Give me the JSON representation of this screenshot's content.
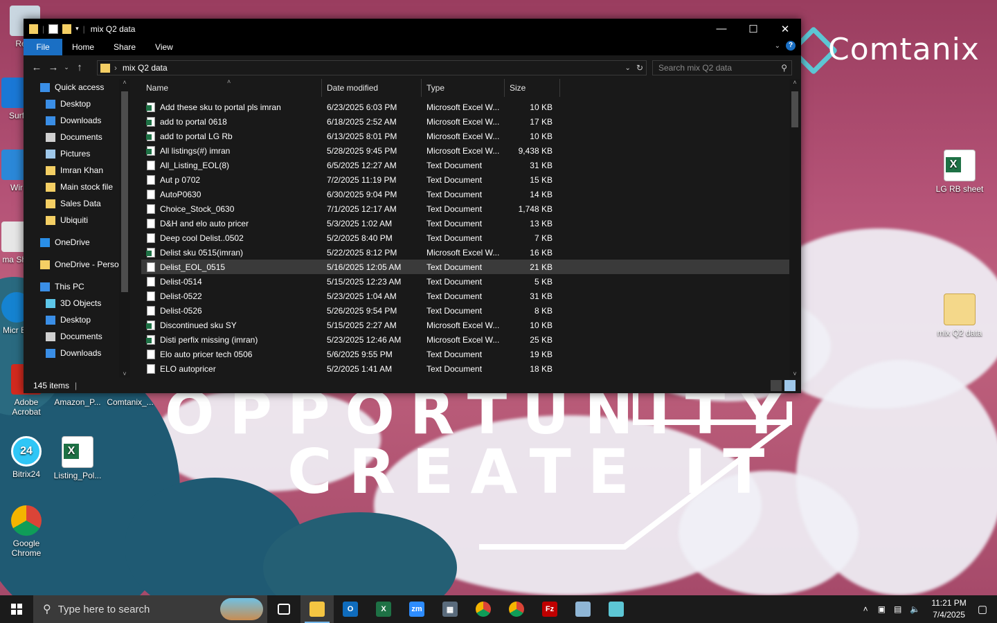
{
  "desktop": {
    "brand": "Comtanix",
    "slogan_line1": "OPPORTUNITY",
    "slogan_line2": "CREATE IT",
    "icons_left": [
      {
        "label": "Recy"
      },
      {
        "label": "Surf"
      },
      {
        "label": "Wir"
      },
      {
        "label": "ma Sho"
      },
      {
        "label": "Micr Ec"
      },
      {
        "label": "Adobe Acrobat"
      },
      {
        "label": "Amazon_P..."
      },
      {
        "label": "Comtanix_..."
      },
      {
        "label": "Bitrix24"
      },
      {
        "label": "Listing_Pol..."
      },
      {
        "label": "Google Chrome"
      }
    ],
    "icons_right": [
      {
        "label": "LG RB sheet"
      },
      {
        "label": "mix Q2 data"
      }
    ]
  },
  "window": {
    "title": "mix Q2 data",
    "ribbon_tabs": [
      "File",
      "Home",
      "Share",
      "View"
    ],
    "address": {
      "crumb": "mix Q2 data"
    },
    "search_placeholder": "Search mix Q2 data",
    "nav": [
      {
        "label": "Quick access",
        "icon": "star-icon",
        "indent": 1,
        "pinned": false
      },
      {
        "label": "Desktop",
        "icon": "desktop-icon",
        "indent": 2,
        "pinned": true
      },
      {
        "label": "Downloads",
        "icon": "download-icon",
        "indent": 2,
        "pinned": true
      },
      {
        "label": "Documents",
        "icon": "document-icon",
        "indent": 2,
        "pinned": true
      },
      {
        "label": "Pictures",
        "icon": "pictures-icon",
        "indent": 2,
        "pinned": true
      },
      {
        "label": "Imran Khan",
        "icon": "folder-icon",
        "indent": 2,
        "pinned": false
      },
      {
        "label": "Main stock file",
        "icon": "folder-icon",
        "indent": 2,
        "pinned": false
      },
      {
        "label": "Sales Data",
        "icon": "folder-icon",
        "indent": 2,
        "pinned": false
      },
      {
        "label": "Ubiquiti",
        "icon": "folder-icon",
        "indent": 2,
        "pinned": false
      },
      {
        "label": "",
        "icon": "",
        "indent": 0,
        "pinned": false
      },
      {
        "label": "OneDrive",
        "icon": "cloud-icon",
        "indent": 1,
        "pinned": false
      },
      {
        "label": "",
        "icon": "",
        "indent": 0,
        "pinned": false
      },
      {
        "label": "OneDrive - Persor",
        "icon": "folder-icon",
        "indent": 1,
        "pinned": false
      },
      {
        "label": "",
        "icon": "",
        "indent": 0,
        "pinned": false
      },
      {
        "label": "This PC",
        "icon": "pc-icon",
        "indent": 1,
        "pinned": false
      },
      {
        "label": "3D Objects",
        "icon": "cube-icon",
        "indent": 2,
        "pinned": false
      },
      {
        "label": "Desktop",
        "icon": "desktop-icon",
        "indent": 2,
        "pinned": false
      },
      {
        "label": "Documents",
        "icon": "document-icon",
        "indent": 2,
        "pinned": false
      },
      {
        "label": "Downloads",
        "icon": "download-icon",
        "indent": 2,
        "pinned": false
      }
    ],
    "columns": [
      "Name",
      "Date modified",
      "Type",
      "Size"
    ],
    "files": [
      {
        "name": "Add these sku to portal pls imran",
        "date": "6/23/2025 6:03 PM",
        "type": "Microsoft Excel W...",
        "size": "10 KB",
        "kind": "xl"
      },
      {
        "name": "add to portal 0618",
        "date": "6/18/2025 2:52 AM",
        "type": "Microsoft Excel W...",
        "size": "17 KB",
        "kind": "xl"
      },
      {
        "name": "add to portal LG Rb",
        "date": "6/13/2025 8:01 PM",
        "type": "Microsoft Excel W...",
        "size": "10 KB",
        "kind": "xl"
      },
      {
        "name": "All listings(#) imran",
        "date": "5/28/2025 9:45 PM",
        "type": "Microsoft Excel W...",
        "size": "9,438 KB",
        "kind": "xl"
      },
      {
        "name": "All_Listing_EOL(8)",
        "date": "6/5/2025 12:27 AM",
        "type": "Text Document",
        "size": "31 KB",
        "kind": "txt"
      },
      {
        "name": "Aut p 0702",
        "date": "7/2/2025 11:19 PM",
        "type": "Text Document",
        "size": "15 KB",
        "kind": "txt"
      },
      {
        "name": "AutoP0630",
        "date": "6/30/2025 9:04 PM",
        "type": "Text Document",
        "size": "14 KB",
        "kind": "txt"
      },
      {
        "name": "Choice_Stock_0630",
        "date": "7/1/2025 12:17 AM",
        "type": "Text Document",
        "size": "1,748 KB",
        "kind": "txt"
      },
      {
        "name": "D&H and elo auto pricer",
        "date": "5/3/2025 1:02 AM",
        "type": "Text Document",
        "size": "13 KB",
        "kind": "txt"
      },
      {
        "name": "Deep cool Delist..0502",
        "date": "5/2/2025 8:40 PM",
        "type": "Text Document",
        "size": "7 KB",
        "kind": "txt"
      },
      {
        "name": "Delist sku 0515(imran)",
        "date": "5/22/2025 8:12 PM",
        "type": "Microsoft Excel W...",
        "size": "16 KB",
        "kind": "xl"
      },
      {
        "name": "Delist_EOL_0515",
        "date": "5/16/2025 12:05 AM",
        "type": "Text Document",
        "size": "21 KB",
        "kind": "txt",
        "selected": true
      },
      {
        "name": "Delist-0514",
        "date": "5/15/2025 12:23 AM",
        "type": "Text Document",
        "size": "5 KB",
        "kind": "txt"
      },
      {
        "name": "Delist-0522",
        "date": "5/23/2025 1:04 AM",
        "type": "Text Document",
        "size": "31 KB",
        "kind": "txt"
      },
      {
        "name": "Delist-0526",
        "date": "5/26/2025 9:54 PM",
        "type": "Text Document",
        "size": "8 KB",
        "kind": "txt"
      },
      {
        "name": "Discontinued sku SY",
        "date": "5/15/2025 2:27 AM",
        "type": "Microsoft Excel W...",
        "size": "10 KB",
        "kind": "xl"
      },
      {
        "name": "Disti perfix missing (imran)",
        "date": "5/23/2025 12:46 AM",
        "type": "Microsoft Excel W...",
        "size": "25 KB",
        "kind": "xl"
      },
      {
        "name": "Elo auto pricer tech 0506",
        "date": "5/6/2025 9:55 PM",
        "type": "Text Document",
        "size": "19 KB",
        "kind": "txt"
      },
      {
        "name": "ELO autopricer",
        "date": "5/2/2025 1:41 AM",
        "type": "Text Document",
        "size": "18 KB",
        "kind": "txt"
      }
    ],
    "status": "145 items"
  },
  "taskbar": {
    "search_placeholder": "Type here to search",
    "apps": [
      {
        "name": "task-view-icon",
        "label": "",
        "color": "#1b1b1b"
      },
      {
        "name": "file-explorer-icon",
        "label": "",
        "color": "#f4c542",
        "active": true
      },
      {
        "name": "outlook-icon",
        "label": "O",
        "color": "#0f6cbd"
      },
      {
        "name": "excel-icon",
        "label": "X",
        "color": "#1e7145"
      },
      {
        "name": "zoom-icon",
        "label": "zm",
        "color": "#2d8cff"
      },
      {
        "name": "calculator-icon",
        "label": "▦",
        "color": "#5a6b7c"
      },
      {
        "name": "chrome-icon",
        "label": "",
        "color": "#db4437"
      },
      {
        "name": "chrome-profile-icon",
        "label": "",
        "color": "#0f9d58"
      },
      {
        "name": "filezilla-icon",
        "label": "Fz",
        "color": "#bf0000"
      },
      {
        "name": "notes-icon",
        "label": "",
        "color": "#8fb6d6"
      },
      {
        "name": "comtanix-app-icon",
        "label": "",
        "color": "#5dc6d4"
      }
    ],
    "time": "11:21 PM",
    "date": "7/4/2025"
  }
}
